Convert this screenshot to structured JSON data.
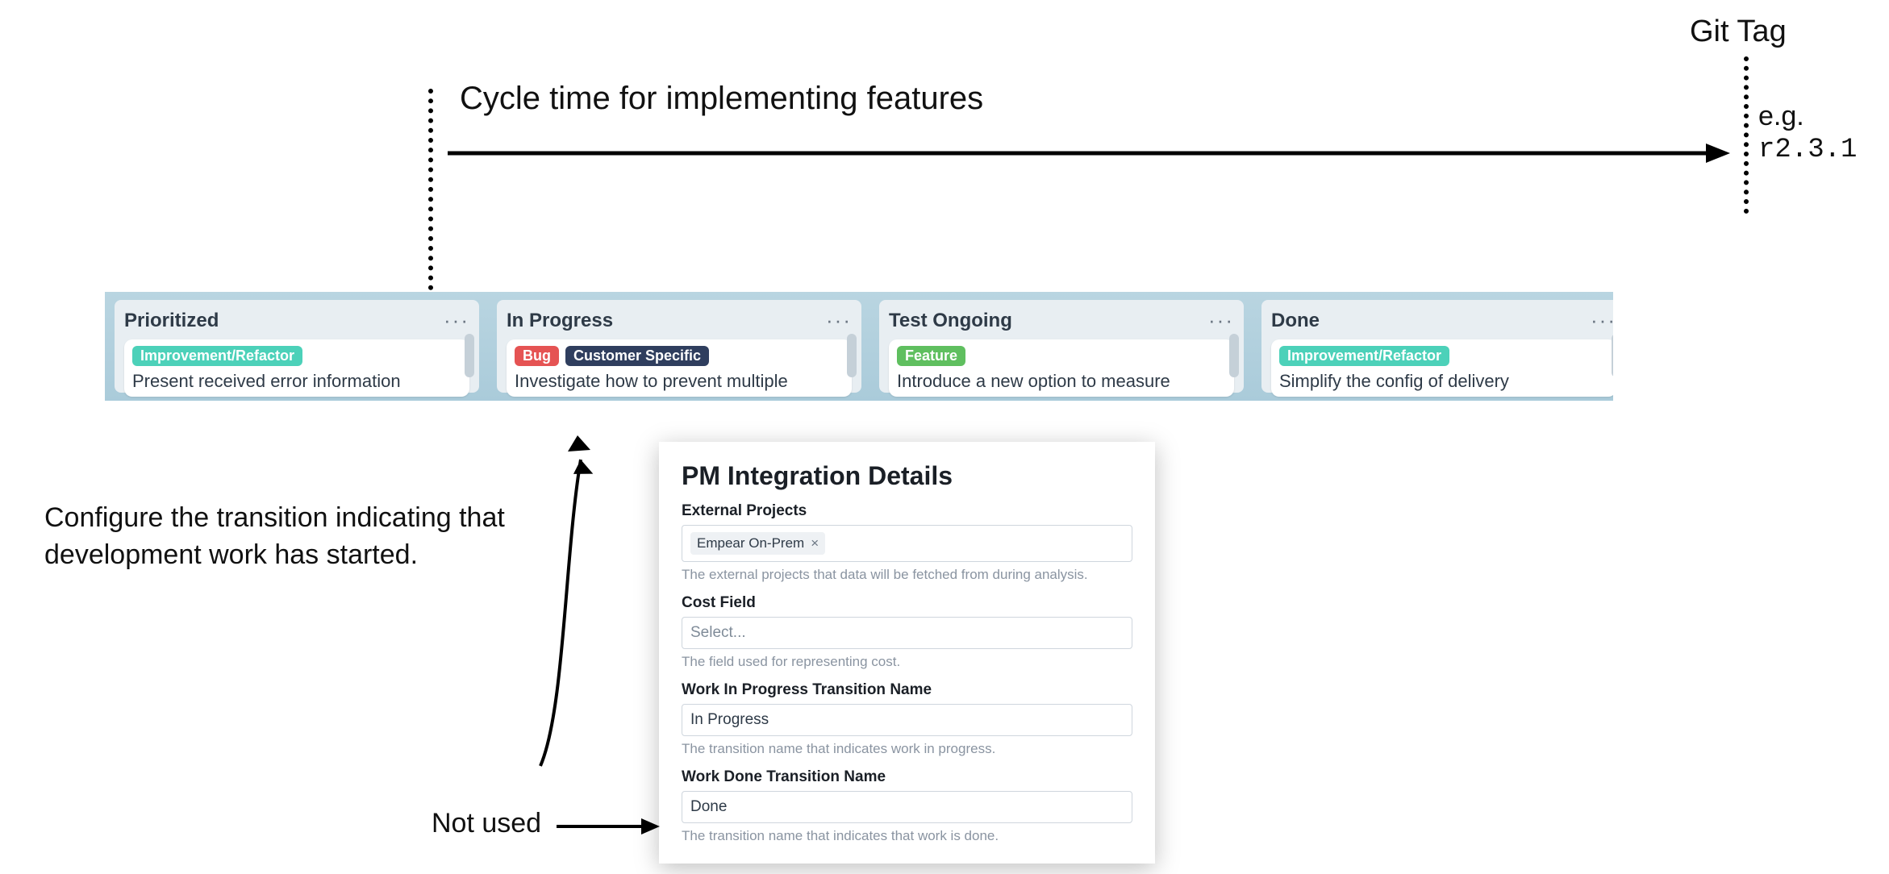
{
  "diagram": {
    "git_tag_label": "Git Tag",
    "git_tag_example_prefix": "e.g. ",
    "git_tag_example_code": "r2.3.1",
    "cycle_time_title": "Cycle time for implementing features",
    "anno_configure": "Configure the transition indicating that development work has started.",
    "anno_notused": "Not used"
  },
  "board": {
    "columns": [
      {
        "title": "Prioritized",
        "card": {
          "labels": [
            {
              "text": "Improvement/Refactor",
              "kind": "teal"
            }
          ],
          "title": "Present received error information"
        }
      },
      {
        "title": "In Progress",
        "card": {
          "labels": [
            {
              "text": "Bug",
              "kind": "red"
            },
            {
              "text": "Customer Specific",
              "kind": "navy"
            }
          ],
          "title": "Investigate how to prevent multiple"
        }
      },
      {
        "title": "Test Ongoing",
        "card": {
          "labels": [
            {
              "text": "Feature",
              "kind": "green"
            }
          ],
          "title": "Introduce a new option to measure"
        }
      },
      {
        "title": "Done",
        "card": {
          "labels": [
            {
              "text": "Improvement/Refactor",
              "kind": "teal"
            }
          ],
          "title": "Simplify the config of delivery"
        }
      }
    ]
  },
  "panel": {
    "heading": "PM Integration Details",
    "external_projects": {
      "label": "External Projects",
      "value": "Empear On-Prem",
      "help": "The external projects that data will be fetched from during analysis."
    },
    "cost_field": {
      "label": "Cost Field",
      "placeholder": "Select...",
      "help": "The field used for representing cost."
    },
    "wip": {
      "label": "Work In Progress Transition Name",
      "value": "In Progress",
      "help": "The transition name that indicates work in progress."
    },
    "done": {
      "label": "Work Done Transition Name",
      "value": "Done",
      "help": "The transition name that indicates that work is done."
    }
  }
}
